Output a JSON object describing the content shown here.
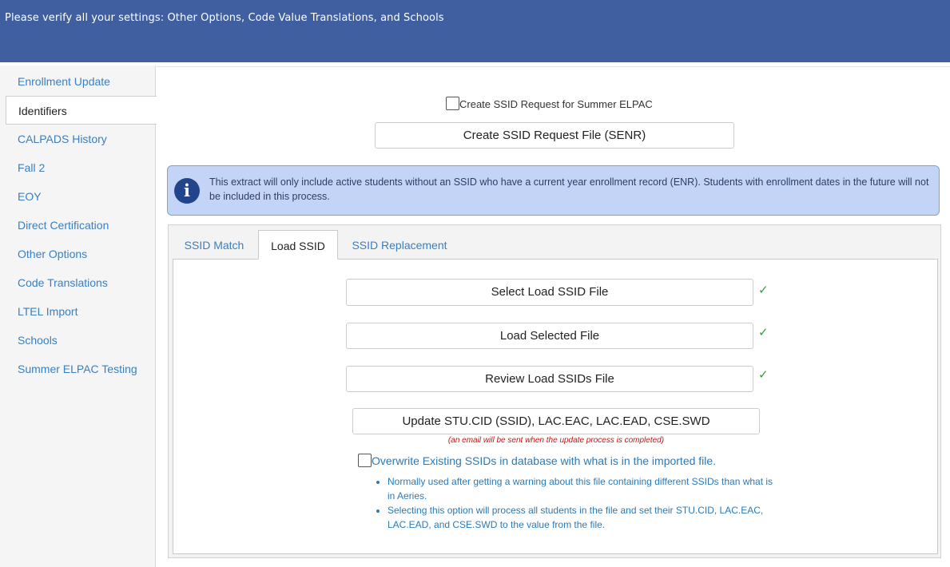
{
  "header": {
    "title": "Please verify all your settings: Other Options, Code Value Translations, and Schools"
  },
  "sidebar": {
    "items": [
      {
        "label": "Enrollment Update",
        "active": false
      },
      {
        "label": "Identifiers",
        "active": true
      },
      {
        "label": "CALPADS History",
        "active": false
      },
      {
        "label": "Fall 2",
        "active": false
      },
      {
        "label": "EOY",
        "active": false
      },
      {
        "label": "Direct Certification",
        "active": false
      },
      {
        "label": "Other Options",
        "active": false
      },
      {
        "label": "Code Translations",
        "active": false
      },
      {
        "label": "LTEL Import",
        "active": false
      },
      {
        "label": "Schools",
        "active": false
      },
      {
        "label": "Summer ELPAC Testing",
        "active": false
      }
    ]
  },
  "main": {
    "summer_checkbox_label": "Create SSID Request for Summer ELPAC",
    "summer_checkbox_checked": false,
    "create_button_label": "Create SSID Request File (SENR)",
    "info_text": "This extract will only include active students without an SSID who have a current year enrollment record (ENR). Students with enrollment dates in the future will not be included in this process.",
    "info_icon": "info-circle-icon",
    "tabs": [
      {
        "label": "SSID Match",
        "active": false
      },
      {
        "label": "Load SSID",
        "active": true
      },
      {
        "label": "SSID Replacement",
        "active": false
      }
    ],
    "load_ssid": {
      "select_button": "Select Load SSID File",
      "load_button": "Load Selected File",
      "review_button": "Review Load SSIDs File",
      "check_glyph": "✓",
      "update_button": "Update STU.CID (SSID), LAC.EAC, LAC.EAD, CSE.SWD",
      "email_note": "(an email will be sent when the update process is completed)",
      "overwrite_label": "Overwrite Existing SSIDs in database with what is in the imported file.",
      "overwrite_checked": false,
      "notes": [
        "Normally used after getting a warning about this file containing different SSIDs than what is in Aeries.",
        "Selecting this option will process all students in the file and set their STU.CID, LAC.EAC, LAC.EAD, and CSE.SWD to the value from the file."
      ]
    }
  },
  "colors": {
    "header_bg": "#3f5fa0",
    "link": "#3a7fc1",
    "info_bg": "#c4d4f7",
    "check": "#3c9a3c",
    "note_red": "#cc1111"
  }
}
